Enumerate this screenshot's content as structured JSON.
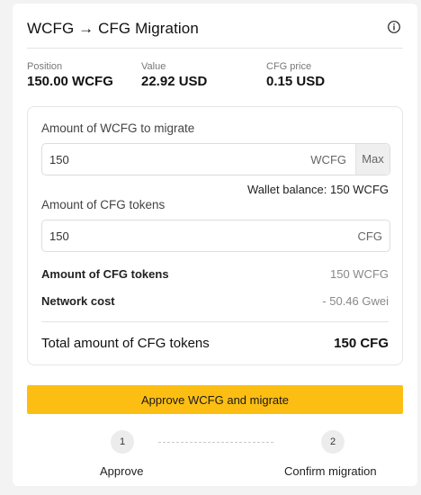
{
  "header": {
    "title": "WCFG → CFG Migration",
    "info_icon": "info-icon"
  },
  "stats": [
    {
      "label": "Position",
      "value": "150.00 WCFG"
    },
    {
      "label": "Value",
      "value": "22.92 USD"
    },
    {
      "label": "CFG price",
      "value": "0.15 USD"
    }
  ],
  "form": {
    "wcfg_label": "Amount of WCFG to migrate",
    "wcfg_value": "150",
    "wcfg_unit": "WCFG",
    "max_label": "Max",
    "wallet_balance": "Wallet balance: 150 WCFG",
    "cfg_label": "Amount of CFG tokens",
    "cfg_value": "150",
    "cfg_unit": "CFG"
  },
  "summary": {
    "rows": [
      {
        "key": "Amount of CFG tokens",
        "value": "150 WCFG"
      },
      {
        "key": "Network cost",
        "value": "- 50.46 Gwei"
      }
    ],
    "total_key": "Total amount of CFG tokens",
    "total_value": "150 CFG"
  },
  "primary_button": {
    "label": "Approve WCFG and migrate"
  },
  "steps": [
    {
      "number": "1",
      "label": "Approve"
    },
    {
      "number": "2",
      "label": "Confirm migration"
    }
  ],
  "colors": {
    "accent": "#fcbe12",
    "background": "#f3f3f3",
    "card": "#ffffff"
  }
}
